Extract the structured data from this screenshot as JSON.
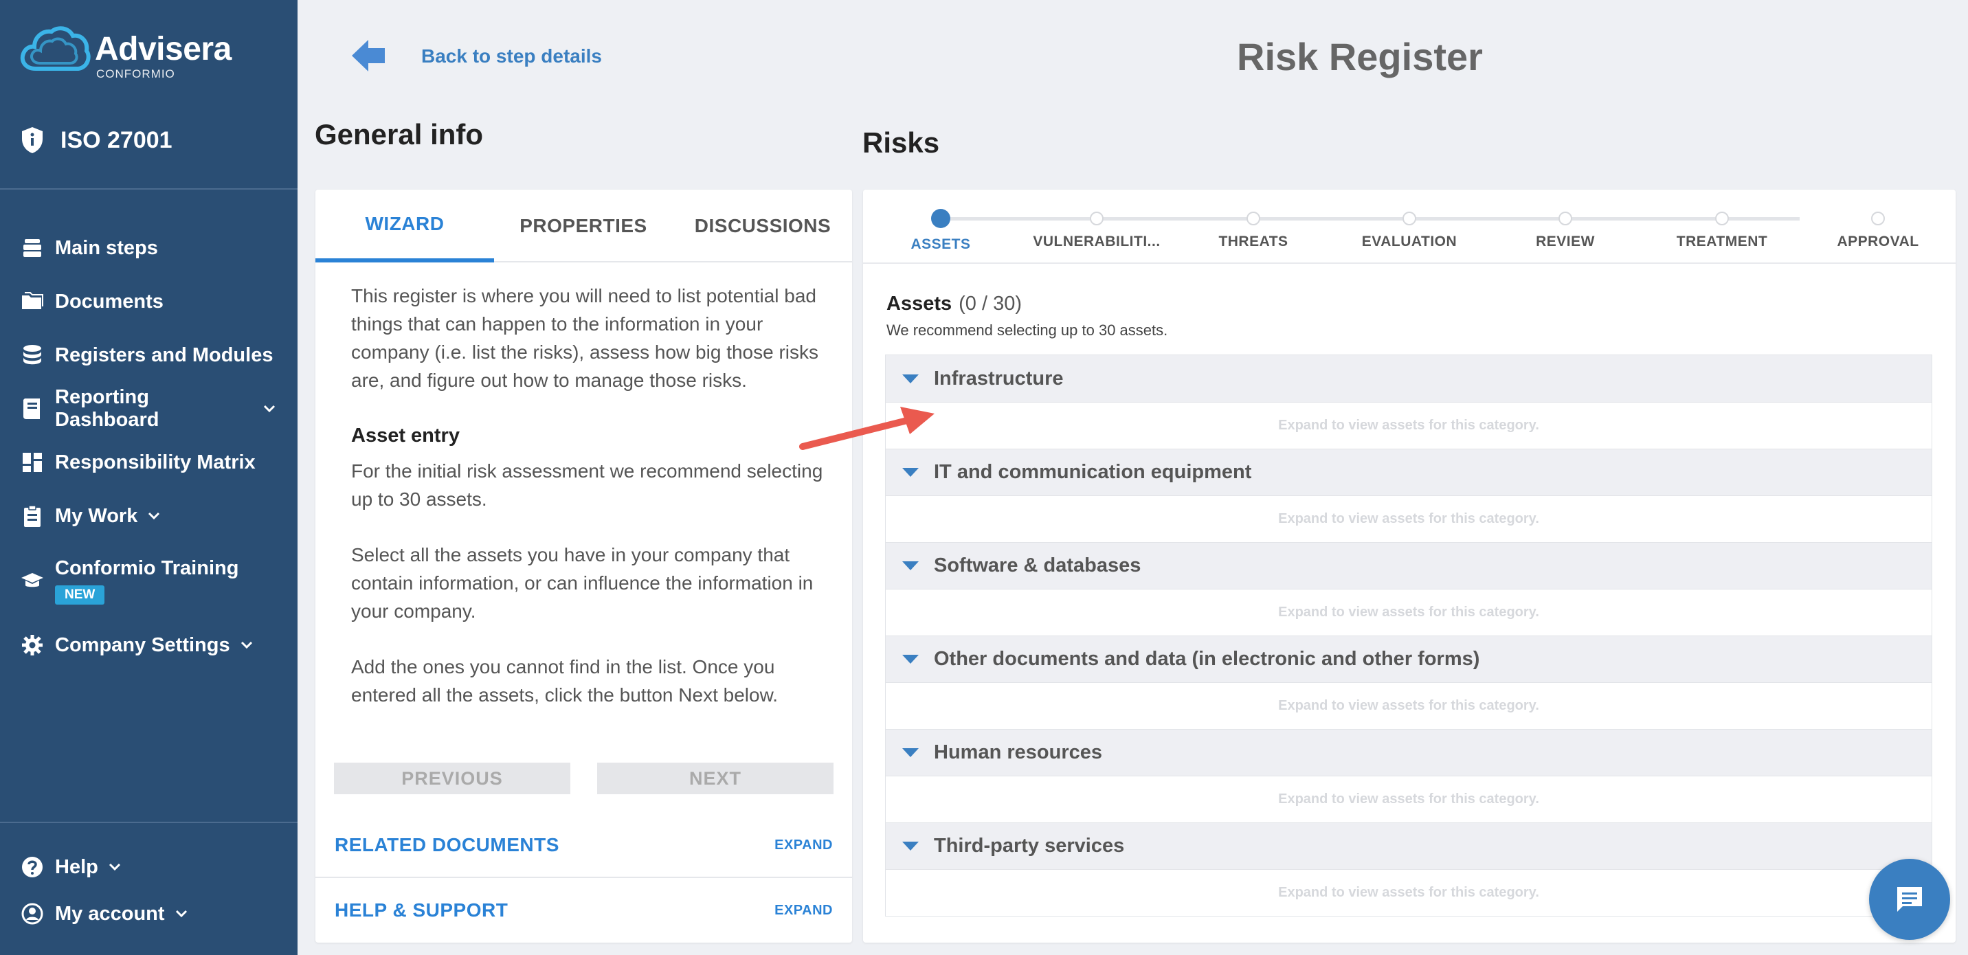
{
  "brand": {
    "name": "Advisera",
    "sub": "CONFORMIO"
  },
  "project": "ISO 27001",
  "nav": {
    "items": [
      {
        "label": "Main steps",
        "icon": "steps-icon"
      },
      {
        "label": "Documents",
        "icon": "folder-icon"
      },
      {
        "label": "Registers and Modules",
        "icon": "database-icon"
      },
      {
        "label": "Reporting Dashboard",
        "icon": "report-icon"
      },
      {
        "label": "Responsibility Matrix",
        "icon": "grid-icon"
      },
      {
        "label": "My Work",
        "icon": "clipboard-icon"
      },
      {
        "label": "Conformio Training",
        "icon": "graduation-icon",
        "badge": "NEW"
      },
      {
        "label": "Company Settings",
        "icon": "gear-icon"
      }
    ],
    "bottom": [
      {
        "label": "Help",
        "icon": "help-icon"
      },
      {
        "label": "My account",
        "icon": "account-icon"
      }
    ]
  },
  "header": {
    "back_label": "Back to step details",
    "title": "Risk Register"
  },
  "general": {
    "title": "General info",
    "tabs": [
      "WIZARD",
      "PROPERTIES",
      "DISCUSSIONS"
    ],
    "intro": "This register is where you will need to list potential bad things that can happen to the information in your company (i.e. list the risks), assess how big those risks are, and figure out how to manage those risks.",
    "asset_heading": "Asset entry",
    "para1": "For the initial risk assessment we recommend selecting up to 30 assets.",
    "para2": "Select all the assets you have in your company that contain information, or can influence the information in your company.",
    "para3": "Add the ones you cannot find in the list. Once you entered all the assets, click the button Next below.",
    "prev_label": "PREVIOUS",
    "next_label": "NEXT",
    "related_docs": "RELATED DOCUMENTS",
    "help_support": "HELP & SUPPORT",
    "expand": "EXPAND"
  },
  "risks": {
    "title": "Risks",
    "steps": [
      "ASSETS",
      "VULNERABILITI...",
      "THREATS",
      "EVALUATION",
      "REVIEW",
      "TREATMENT",
      "APPROVAL"
    ],
    "assets_label": "Assets",
    "assets_count": "(0 / 30)",
    "assets_rec": "We recommend selecting up to 30 assets.",
    "expand_hint": "Expand to view assets for this category.",
    "categories": [
      "Infrastructure",
      "IT and communication equipment",
      "Software & databases",
      "Other documents and data (in electronic and other forms)",
      "Human resources",
      "Third-party services"
    ]
  },
  "colors": {
    "sidebar": "#2a4e74",
    "accent": "#3a7fc1",
    "link": "#2a82d6",
    "annotation": "#ea5a4f"
  }
}
